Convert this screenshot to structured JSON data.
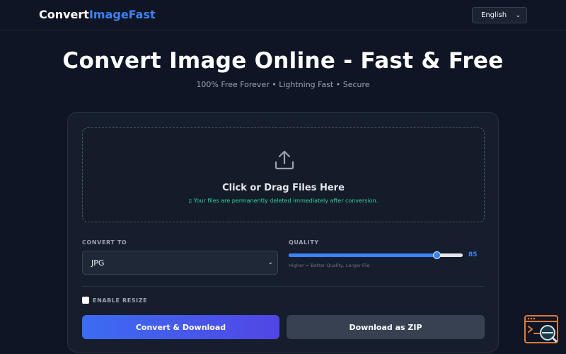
{
  "header": {
    "logo_main": "Convert",
    "logo_accent": "ImageFast",
    "language": "English"
  },
  "hero": {
    "title": "Convert Image Online - Fast & Free",
    "subtitle": "100% Free Forever • Lightning Fast • Secure"
  },
  "dropzone": {
    "title": "Click or Drag Files Here",
    "note": "▯ Your files are permanently deleted immediately after conversion."
  },
  "convert_to": {
    "label": "CONVERT TO",
    "selected": "JPG"
  },
  "quality": {
    "label": "QUALITY",
    "value": 85,
    "value_text": "85",
    "hint": "Higher = Better Quality, Larger File"
  },
  "resize": {
    "label": "ENABLE RESIZE",
    "checked": false
  },
  "buttons": {
    "convert": "Convert & Download",
    "zip": "Download as ZIP"
  },
  "colors": {
    "accent": "#3b82f6",
    "background": "#0f1524",
    "card": "#161e2d",
    "success_text": "#34d399"
  },
  "icons": {
    "upload": "upload-icon",
    "chevron": "chevron-down-icon",
    "widget": "console-search-icon"
  }
}
